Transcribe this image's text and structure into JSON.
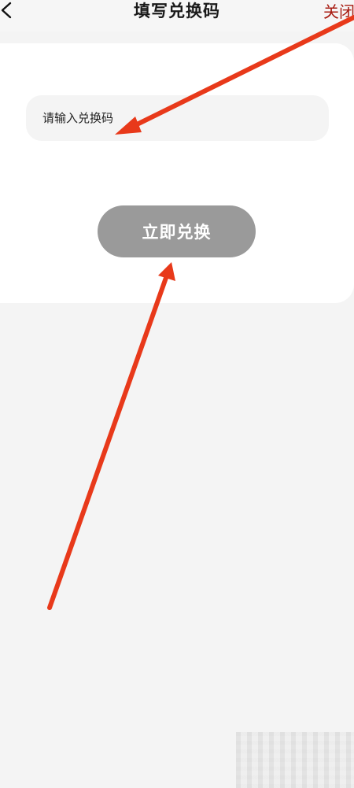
{
  "header": {
    "title": "填写兑换码",
    "close_label": "关闭",
    "back_icon": "chevron-left-icon"
  },
  "form": {
    "code_placeholder": "请输入兑换码",
    "code_value": "",
    "redeem_label": "立即兑换",
    "redeem_button_color": "#9a9a9a"
  },
  "annotations": {
    "arrow_color": "#e8391a"
  }
}
